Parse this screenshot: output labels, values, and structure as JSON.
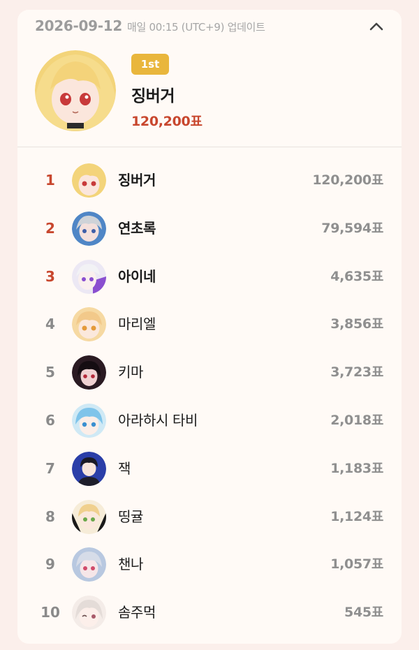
{
  "header": {
    "date": "2026-09-12",
    "update_note": "매일 00:15 (UTC+9) 업데이트",
    "collapse_icon": "chevron-up-icon"
  },
  "winner": {
    "badge": "1st",
    "name": "징버거",
    "votes": "120,200표",
    "badge_color": "#e9b63c",
    "votes_color": "#c8472e"
  },
  "ranking": [
    {
      "rank": "1",
      "name": "징버거",
      "votes": "120,200표"
    },
    {
      "rank": "2",
      "name": "연초록",
      "votes": "79,594표"
    },
    {
      "rank": "3",
      "name": "아이네",
      "votes": "4,635표"
    },
    {
      "rank": "4",
      "name": "마리엘",
      "votes": "3,856표"
    },
    {
      "rank": "5",
      "name": "키마",
      "votes": "3,723표"
    },
    {
      "rank": "6",
      "name": "아라하시 타비",
      "votes": "2,018표"
    },
    {
      "rank": "7",
      "name": "잭",
      "votes": "1,183표"
    },
    {
      "rank": "8",
      "name": "띵귤",
      "votes": "1,124표"
    },
    {
      "rank": "9",
      "name": "챈나",
      "votes": "1,057표"
    },
    {
      "rank": "10",
      "name": "솜주먹",
      "votes": "545표"
    }
  ],
  "colors": {
    "background": "#fbefeb",
    "card": "#fffaf6",
    "top_rank": "#c8472e",
    "rank": "#8a8a8a"
  }
}
